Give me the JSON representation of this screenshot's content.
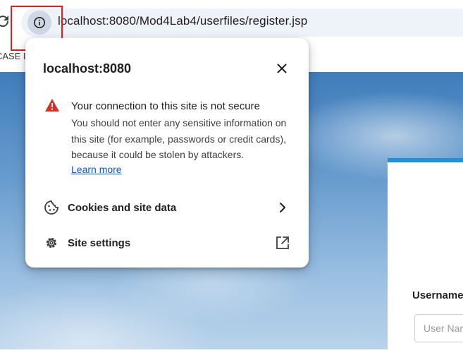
{
  "browser": {
    "url": "localhost:8080/Mod4Lab4/userfiles/register.jsp",
    "bookmark_fragment": "CASE I"
  },
  "popup": {
    "title": "localhost:8080",
    "warning_title": "Your connection to this site is not secure",
    "warning_body": "You should not enter any sensitive information on this site (for example, passwords or credit cards), because it could be stolen by attackers.",
    "learn_more": "Learn more",
    "cookies_label": "Cookies and site data",
    "settings_label": "Site settings"
  },
  "page": {
    "username_label": "Username",
    "username_placeholder": "User Name"
  },
  "icons": {
    "info": "info-icon",
    "warning": "warning-triangle-icon",
    "cookie": "cookie-icon",
    "gear": "gear-icon",
    "chevron": "chevron-right-icon",
    "external": "open-in-new-icon",
    "close": "close-icon",
    "reload": "reload-icon"
  },
  "colors": {
    "warning": "#d93025",
    "link": "#0b57d0",
    "annotation": "#e01e1e",
    "card_accent": "#1e90d8"
  }
}
